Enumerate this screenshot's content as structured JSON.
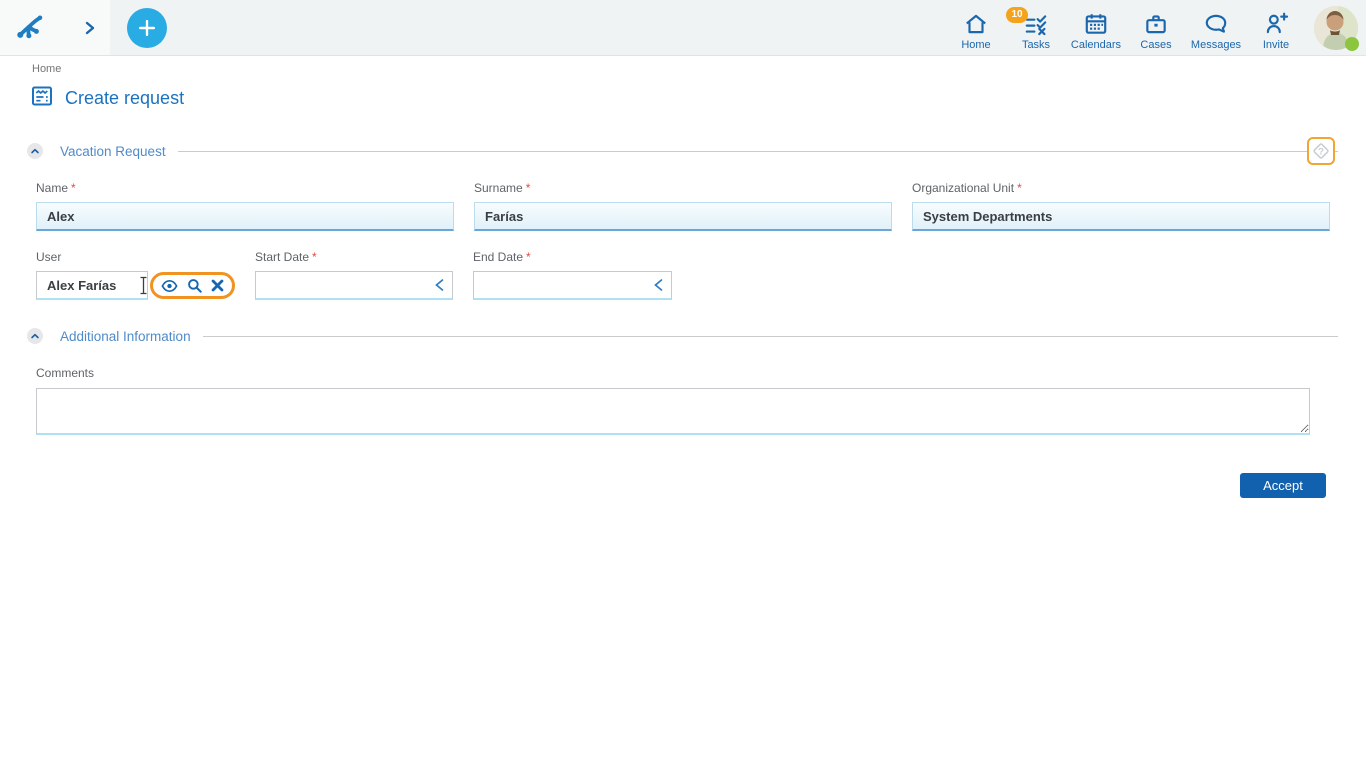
{
  "app": {
    "colors": {
      "nav_blue": "#1b67ad",
      "title_blue": "#1b72c0",
      "cyan_accent": "#29abe3",
      "badge_orange": "#f5a31c",
      "highlight_orange": "#f09320",
      "accept_blue": "#1161ae",
      "status_green": "#8cc63e",
      "required_red": "#e5483f"
    }
  },
  "topbar": {
    "nav": [
      {
        "label": "Home",
        "icon": "home-icon"
      },
      {
        "label": "Tasks",
        "icon": "tasks-icon",
        "badge": "10"
      },
      {
        "label": "Calendars",
        "icon": "calendar-icon"
      },
      {
        "label": "Cases",
        "icon": "briefcase-icon"
      },
      {
        "label": "Messages",
        "icon": "message-icon"
      },
      {
        "label": "Invite",
        "icon": "invite-icon"
      }
    ]
  },
  "breadcrumb": {
    "home": "Home"
  },
  "page": {
    "title": "Create request"
  },
  "sections": {
    "vacation": {
      "title": "Vacation Request"
    },
    "additional": {
      "title": "Additional Information"
    }
  },
  "form": {
    "required_marker": "*",
    "name": {
      "label": "Name",
      "value": "Alex"
    },
    "surname": {
      "label": "Surname",
      "value": "Farías"
    },
    "org_unit": {
      "label": "Organizational Unit",
      "value": "System Departments"
    },
    "user": {
      "label": "User",
      "value": "Alex Farías"
    },
    "start_date": {
      "label": "Start Date",
      "value": ""
    },
    "end_date": {
      "label": "End Date",
      "value": ""
    },
    "comments": {
      "label": "Comments",
      "value": ""
    }
  },
  "actions": {
    "accept_label": "Accept"
  }
}
